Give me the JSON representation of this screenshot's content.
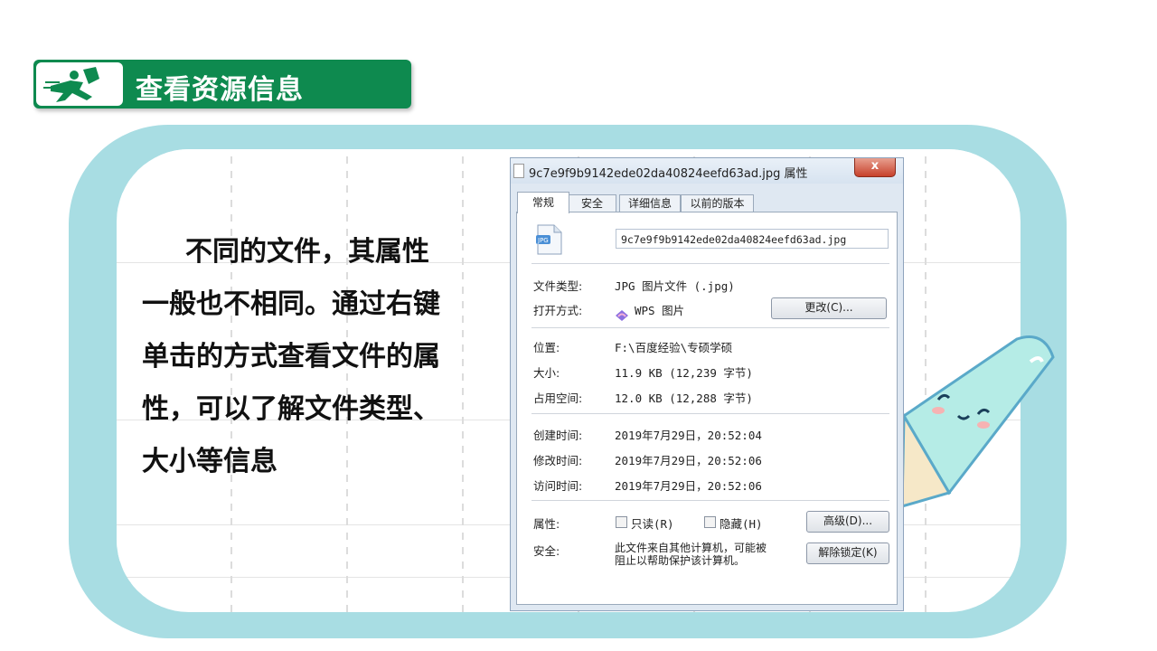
{
  "header": {
    "title": "查看资源信息",
    "icon": "running-man-icon"
  },
  "paragraph": "不同的文件，其属性一般也不相同。通过右键单击的方式查看文件的属性，可以了解文件类型、大小等信息",
  "dialog": {
    "title": "9c7e9f9b9142ede02da40824eefd63ad.jpg 属性",
    "close": "x",
    "tabs": [
      "常规",
      "安全",
      "详细信息",
      "以前的版本"
    ],
    "filename": "9c7e9f9b9142ede02da40824eefd63ad.jpg",
    "file_type_label": "文件类型:",
    "file_type_value": "JPG 图片文件 (.jpg)",
    "open_with_label": "打开方式:",
    "open_with_value": "WPS 图片",
    "change_button": "更改(C)...",
    "location_label": "位置:",
    "location_value": "F:\\百度经验\\专硕学硕",
    "size_label": "大小:",
    "size_value": "11.9 KB (12,239 字节)",
    "disk_size_label": "占用空间:",
    "disk_size_value": "12.0 KB (12,288 字节)",
    "created_label": "创建时间:",
    "created_value": "2019年7月29日，20:52:04",
    "modified_label": "修改时间:",
    "modified_value": "2019年7月29日，20:52:06",
    "accessed_label": "访问时间:",
    "accessed_value": "2019年7月29日，20:52:06",
    "attributes_label": "属性:",
    "readonly_label": "只读(R)",
    "hidden_label": "隐藏(H)",
    "advanced_button": "高级(D)...",
    "security_label": "安全:",
    "security_text_1": "此文件来自其他计算机，可能被",
    "security_text_2": "阻止以帮助保护该计算机。",
    "unblock_button": "解除锁定(K)"
  },
  "colors": {
    "banner": "#0e8a4f",
    "frame": "#a8dde3",
    "pencil": "#b5ece6"
  }
}
